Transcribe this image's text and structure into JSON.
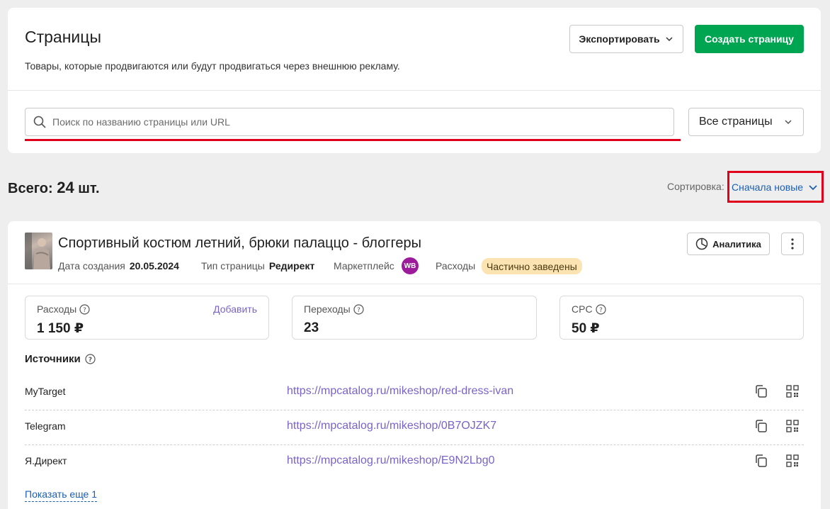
{
  "header": {
    "title": "Страницы",
    "subtitle": "Товары, которые продвигаются или будут продвигаться через внешнюю рекламу.",
    "export_label": "Экспортировать",
    "create_label": "Создать страницу",
    "search_placeholder": "Поиск по названию страницы или URL",
    "filter_value": "Все страницы"
  },
  "summary": {
    "total_label": "Всего:",
    "total_count": "24",
    "total_unit": "шт.",
    "sort_label": "Сортировка:",
    "sort_value": "Сначала новые"
  },
  "item": {
    "title": "Спортивный костюм летний, брюки палаццо - блоггеры",
    "created_label": "Дата создания",
    "created_value": "20.05.2024",
    "type_label": "Тип страницы",
    "type_value": "Редирект",
    "marketplace_label": "Маркетплейс",
    "marketplace_badge": "WB",
    "expenses_label": "Расходы",
    "expenses_status": "Частично заведены",
    "analytics_label": "Аналитика",
    "stats": [
      {
        "label": "Расходы",
        "value": "1 150 ₽",
        "action": "Добавить"
      },
      {
        "label": "Переходы",
        "value": "23"
      },
      {
        "label": "CPC",
        "value": "50 ₽"
      }
    ],
    "sources_title": "Источники",
    "sources": [
      {
        "name": "MyTarget",
        "url": "https://mpcatalog.ru/mikeshop/red-dress-ivan"
      },
      {
        "name": "Telegram",
        "url": "https://mpcatalog.ru/mikeshop/0B7OJZK7"
      },
      {
        "name": "Я.Директ",
        "url": "https://mpcatalog.ru/mikeshop/E9N2Lbg0"
      }
    ],
    "show_more_label": "Показать еще 1"
  },
  "colors": {
    "primary_green": "#00a551",
    "link_purple": "#7a63c9",
    "link_blue": "#1a5fb4",
    "highlight_red": "#e0001b",
    "wb_purple": "#9b1b9b",
    "status_badge_bg": "#fbe3b2"
  }
}
